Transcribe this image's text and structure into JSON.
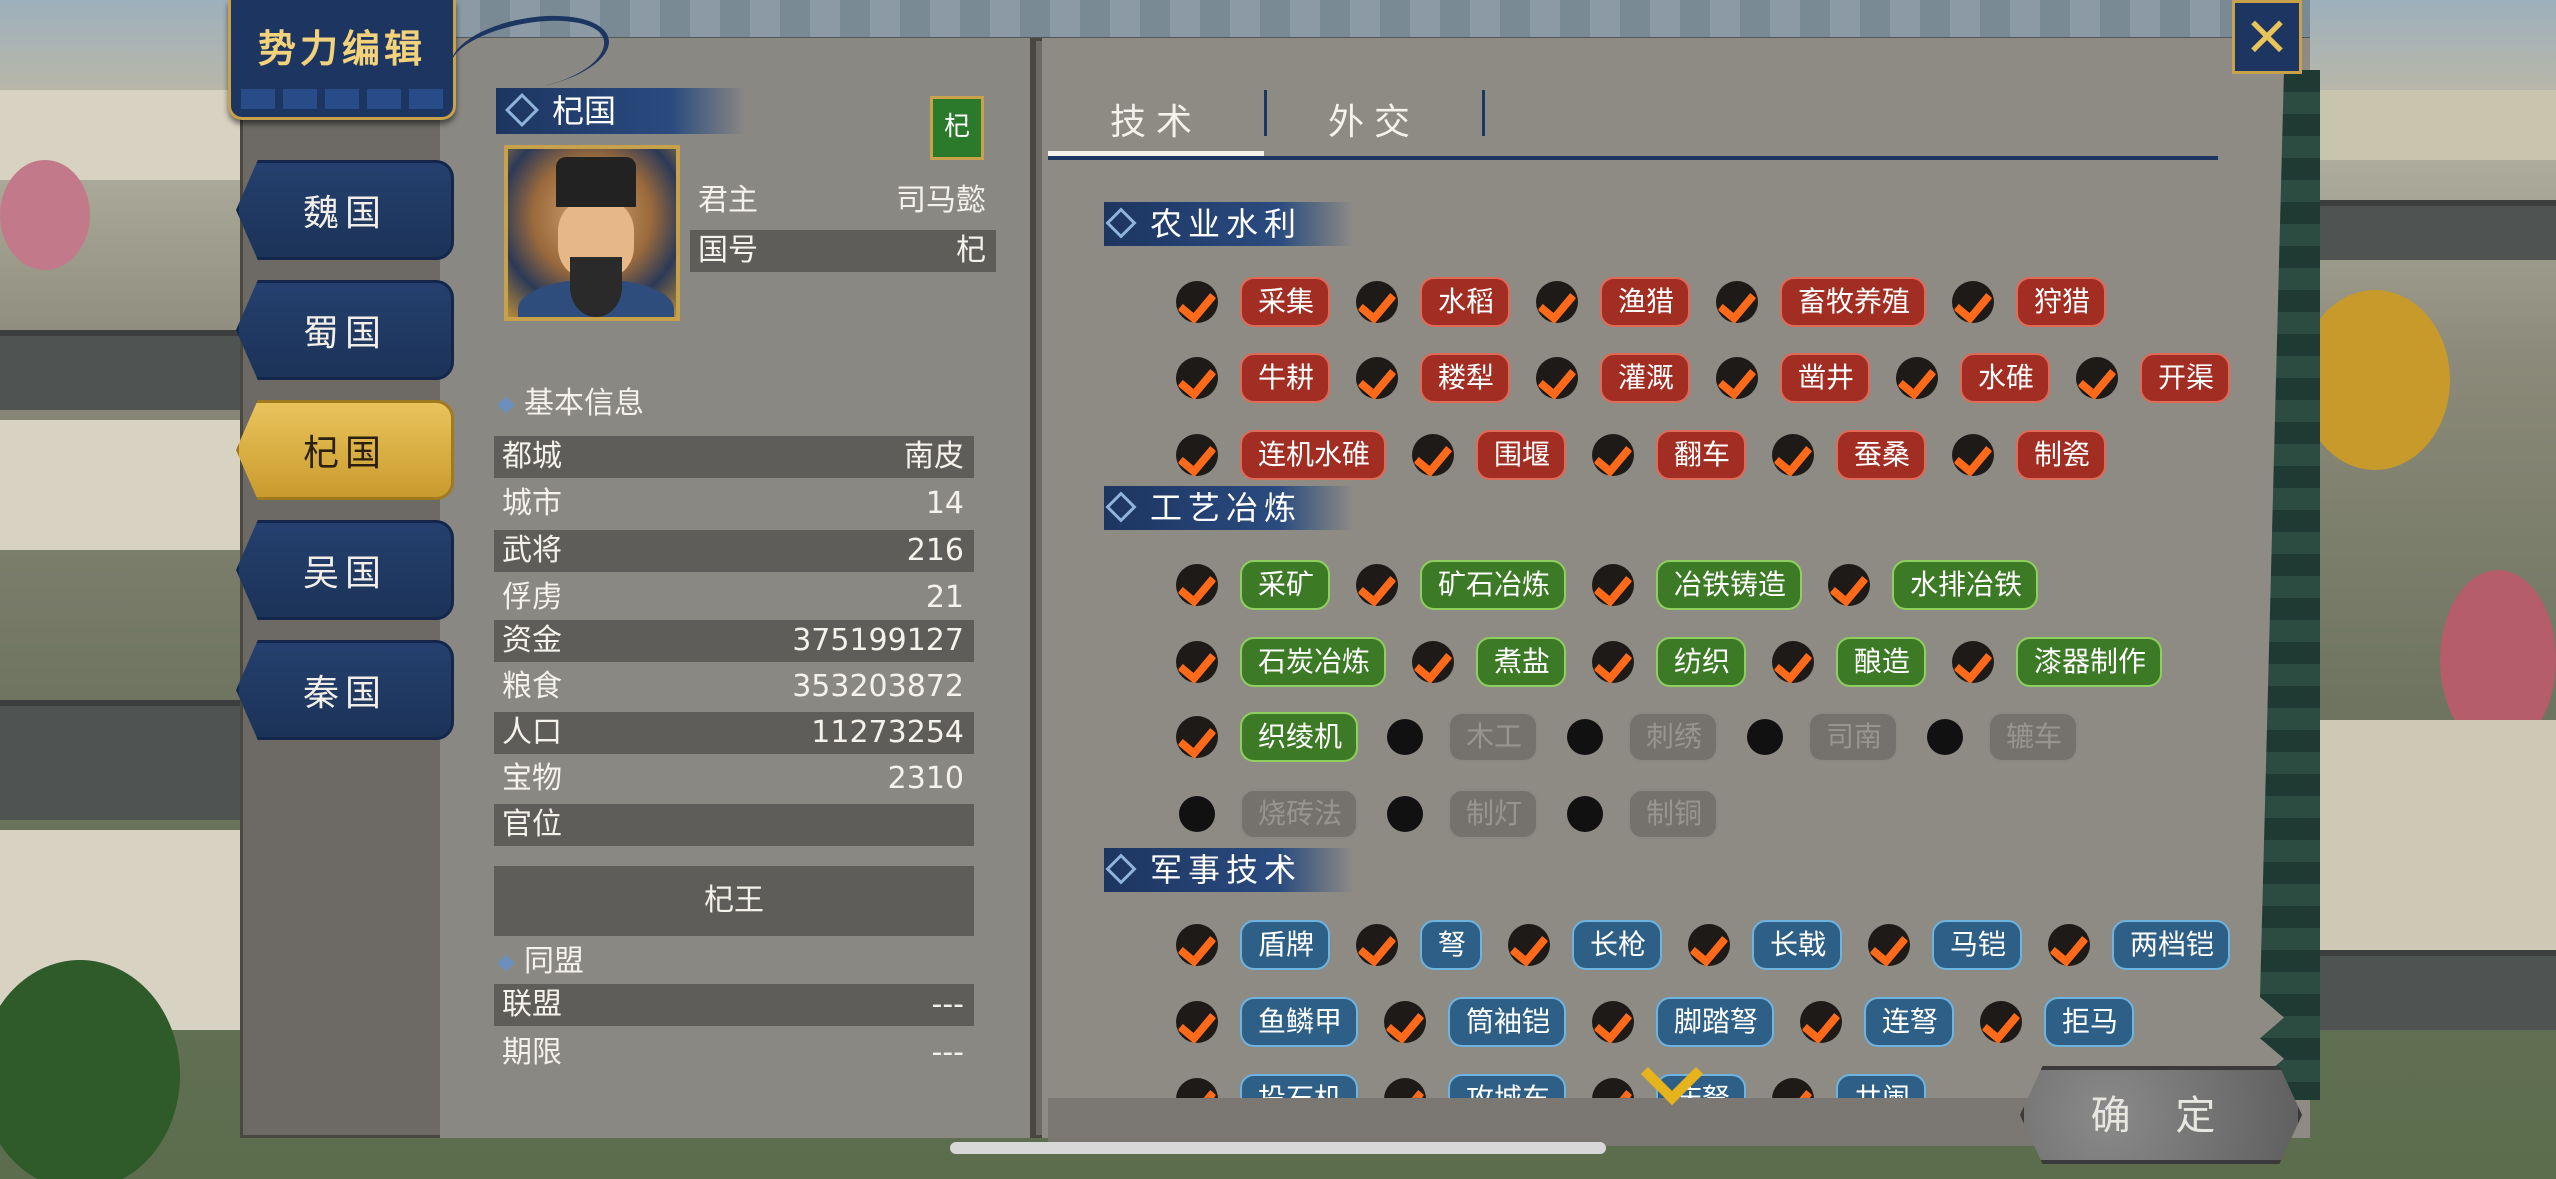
{
  "header": {
    "title": "势力编辑",
    "close_icon": "close-icon"
  },
  "factions": [
    {
      "label": "魏国",
      "active": false
    },
    {
      "label": "蜀国",
      "active": false
    },
    {
      "label": "杞国",
      "active": true
    },
    {
      "label": "吴国",
      "active": false
    },
    {
      "label": "秦国",
      "active": false
    }
  ],
  "nation": {
    "name": "杞国",
    "flag": "杞",
    "ruler_label": "君主",
    "ruler": "司马懿",
    "country_label": "国号",
    "country": "杞"
  },
  "basic": {
    "title": "基本信息",
    "rows": [
      {
        "k": "都城",
        "v": "南皮"
      },
      {
        "k": "城市",
        "v": "14"
      },
      {
        "k": "武将",
        "v": "216"
      },
      {
        "k": "俘虏",
        "v": "21"
      },
      {
        "k": "资金",
        "v": "375199127"
      },
      {
        "k": "粮食",
        "v": "353203872"
      },
      {
        "k": "人口",
        "v": "11273254"
      },
      {
        "k": "宝物",
        "v": "2310"
      },
      {
        "k": "官位",
        "v": ""
      }
    ],
    "title_value": "杞王"
  },
  "alliance": {
    "title": "同盟",
    "rows": [
      {
        "k": "联盟",
        "v": "---"
      },
      {
        "k": "期限",
        "v": "---"
      }
    ]
  },
  "tabs": [
    {
      "label": "技术",
      "active": true
    },
    {
      "label": "外交",
      "active": false
    }
  ],
  "categories": [
    "农业水利",
    "工艺冶炼",
    "军事技术"
  ],
  "tech": {
    "agri": [
      [
        "采集",
        "水稻",
        "渔猎",
        "畜牧养殖",
        "狩猎"
      ],
      [
        "牛耕",
        "耧犁",
        "灌溉",
        "凿井",
        "水碓",
        "开渠"
      ],
      [
        "连机水碓",
        "围堰",
        "翻车",
        "蚕桑",
        "制瓷"
      ]
    ],
    "craft_on": [
      [
        "采矿",
        "矿石冶炼",
        "冶铁铸造",
        "水排冶铁"
      ],
      [
        "石炭冶炼",
        "煮盐",
        "纺织",
        "酿造",
        "漆器制作"
      ],
      [
        "织绫机"
      ]
    ],
    "craft_off": [
      [
        "木工",
        "刺绣",
        "司南",
        "辘车"
      ],
      [
        "烧砖法",
        "制灯",
        "制铜"
      ]
    ],
    "military": [
      [
        "盾牌",
        "弩",
        "长枪",
        "长戟",
        "马铠",
        "两档铠"
      ],
      [
        "鱼鳞甲",
        "筒袖铠",
        "脚踏弩",
        "连弩",
        "拒马"
      ],
      [
        "投石机",
        "攻城车",
        "床弩",
        "井阑"
      ]
    ]
  },
  "confirm": "确 定"
}
